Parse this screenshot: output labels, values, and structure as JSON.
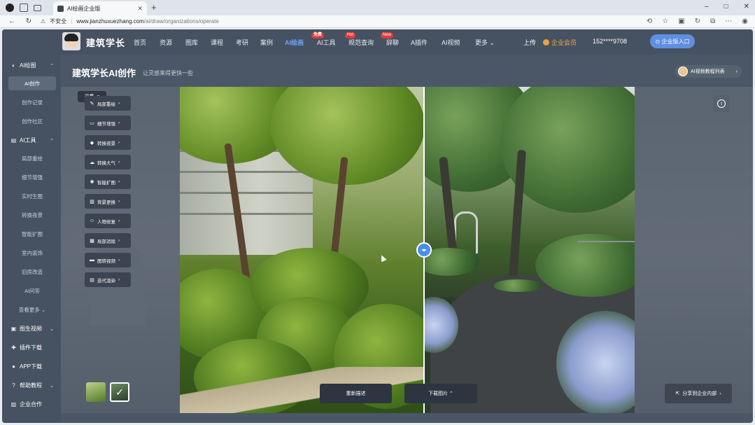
{
  "browser": {
    "tab_title": "AI绘画企业版",
    "security_label": "不安全",
    "url_host": "www.jianzhuxuezhang.com",
    "url_path": "/ai/draw/organizations/operate",
    "window_controls": [
      "–",
      "□",
      "✕"
    ]
  },
  "topnav": {
    "brand": "建筑学长",
    "items": [
      {
        "label": "首页",
        "badge": ""
      },
      {
        "label": "资源",
        "badge": ""
      },
      {
        "label": "图库",
        "badge": ""
      },
      {
        "label": "课程",
        "badge": ""
      },
      {
        "label": "考研",
        "badge": ""
      },
      {
        "label": "案例",
        "badge": ""
      },
      {
        "label": "AI绘画",
        "badge": "免费"
      },
      {
        "label": "AI工具",
        "badge": "Hot"
      },
      {
        "label": "规范查询",
        "badge": "New"
      },
      {
        "label": "辞聊",
        "badge": ""
      },
      {
        "label": "A插件",
        "badge": ""
      },
      {
        "label": "AI视频",
        "badge": ""
      },
      {
        "label": "更多",
        "badge": ""
      }
    ],
    "upload": "上传",
    "vip": "企业会员",
    "phone": "152****9708",
    "enterprise_btn": "企业版入口"
  },
  "sidebar": {
    "groups": [
      {
        "label": "AI绘图",
        "icon": "palette-icon"
      },
      {
        "label": "AI工具",
        "icon": "toolbox-icon"
      },
      {
        "label": "图生视频",
        "icon": "video-icon"
      },
      {
        "label": "插件下载",
        "icon": "puzzle-icon"
      },
      {
        "label": "APP下载",
        "icon": "app-icon"
      },
      {
        "label": "帮助教程",
        "icon": "help-icon"
      },
      {
        "label": "企业合作",
        "icon": "building-icon"
      }
    ],
    "ai_draw_items": [
      "AI创作",
      "创作记录",
      "创作社区"
    ],
    "ai_tool_items": [
      "局部重绘",
      "细节增强",
      "实时生图",
      "转换夜景",
      "智能扩图",
      "室内装饰",
      "旧房改造",
      "AI问答",
      "查看更多"
    ]
  },
  "main": {
    "title": "建筑学长AI创作",
    "subtitle": "让灵感来得更快一些",
    "video_list_btn": "AI视频教程列表",
    "collect_btn": "采集",
    "tools": [
      "局部重绘",
      "细节增强",
      "转换夜景",
      "转换大气",
      "智能扩图",
      "背景更换",
      "人物修复",
      "局部消除",
      "图转视频",
      "迭代渲染"
    ],
    "regenerate_btn": "重新描述",
    "download_btn": "下载图片",
    "share_btn": "分享到企业内部"
  }
}
